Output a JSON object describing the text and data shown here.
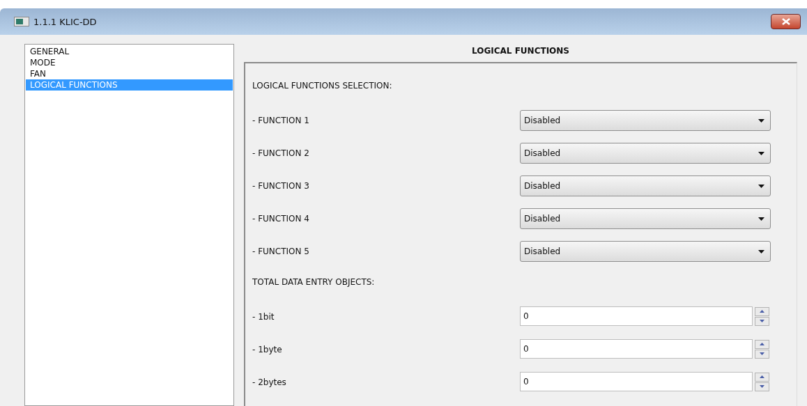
{
  "window": {
    "title": "1.1.1 KLIC-DD"
  },
  "sidebar": {
    "items": [
      {
        "label": "GENERAL",
        "selected": false
      },
      {
        "label": "MODE",
        "selected": false
      },
      {
        "label": "FAN",
        "selected": false
      },
      {
        "label": "LOGICAL FUNCTIONS",
        "selected": true
      }
    ]
  },
  "panel": {
    "title": "LOGICAL FUNCTIONS",
    "sections": [
      {
        "heading": "LOGICAL FUNCTIONS SELECTION:",
        "rows": [
          {
            "kind": "dropdown",
            "label": "- FUNCTION 1",
            "value": "Disabled"
          },
          {
            "kind": "dropdown",
            "label": "- FUNCTION 2",
            "value": "Disabled"
          },
          {
            "kind": "dropdown",
            "label": "- FUNCTION 3",
            "value": "Disabled"
          },
          {
            "kind": "dropdown",
            "label": "- FUNCTION 4",
            "value": "Disabled"
          },
          {
            "kind": "dropdown",
            "label": "- FUNCTION 5",
            "value": "Disabled"
          }
        ]
      },
      {
        "heading": "TOTAL DATA ENTRY OBJECTS:",
        "rows": [
          {
            "kind": "spin",
            "label": "- 1bit",
            "value": "0"
          },
          {
            "kind": "spin",
            "label": "- 1byte",
            "value": "0"
          },
          {
            "kind": "spin",
            "label": "- 2bytes",
            "value": "0"
          }
        ]
      }
    ]
  }
}
